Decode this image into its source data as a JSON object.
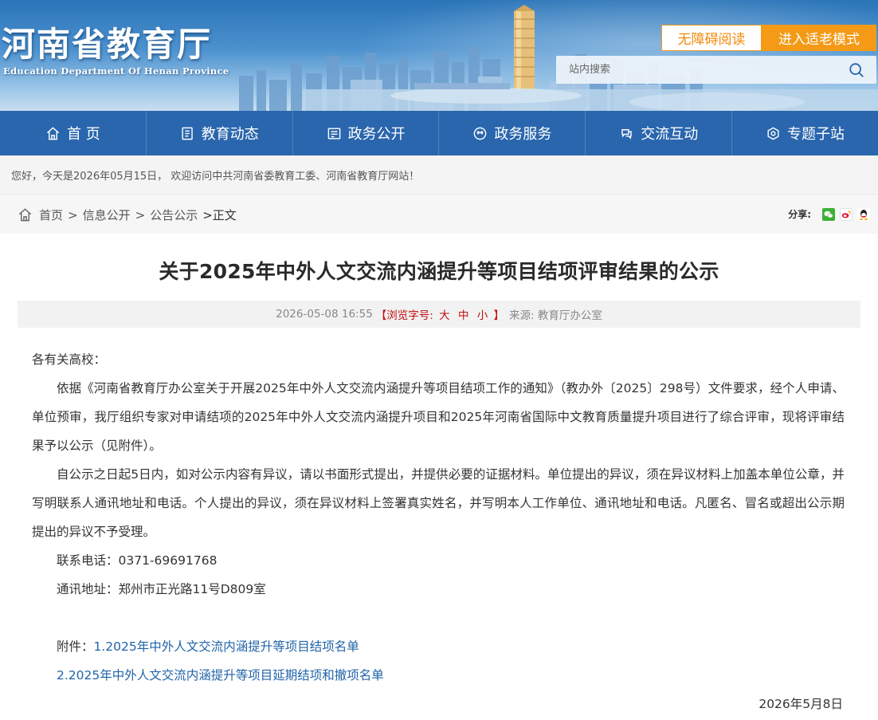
{
  "header": {
    "title_cn": "河南省教育厅",
    "title_en": "Education Department Of Henan Province",
    "accessibility_button": "无障碍阅读",
    "elder_mode_button": "进入适老模式",
    "search_placeholder": "站内搜索"
  },
  "nav": {
    "items": [
      {
        "label": "首 页",
        "icon": "home-icon"
      },
      {
        "label": "教育动态",
        "icon": "news-icon"
      },
      {
        "label": "政务公开",
        "icon": "document-icon"
      },
      {
        "label": "政务服务",
        "icon": "service-icon"
      },
      {
        "label": "交流互动",
        "icon": "chat-icon"
      },
      {
        "label": "专题子站",
        "icon": "topic-icon"
      }
    ]
  },
  "welcome_text": "您好，今天是2026年05月15日，  欢迎访问中共河南省委教育工委、河南省教育厅网站！",
  "breadcrumb": {
    "items": [
      "首页",
      "信息公开",
      "公告公示"
    ],
    "current": ">正文",
    "separator": ">"
  },
  "share": {
    "label": "分享:",
    "targets": [
      "wechat-icon",
      "weibo-icon",
      "qq-icon"
    ]
  },
  "article": {
    "title": "关于2025年中外人文交流内涵提升等项目结项评审结果的公示",
    "date": "2026-05-08 16:55",
    "font_size_prefix": "【浏览字号:",
    "font_size_large": "大",
    "font_size_medium": "中",
    "font_size_small": "小",
    "font_size_suffix": "】",
    "source": "来源: 教育厅办公室",
    "salutation": "各有关高校：",
    "para1": "依据《河南省教育厅办公室关于开展2025年中外人文交流内涵提升等项目结项工作的通知》（教办外〔2025〕298号）文件要求，经个人申请、单位预审，我厅组织专家对申请结项的2025年中外人文交流内涵提升项目和2025年河南省国际中文教育质量提升项目进行了综合评审，现将评审结果予以公示（见附件）。",
    "para2": "自公示之日起5日内，如对公示内容有异议，请以书面形式提出，并提供必要的证据材料。单位提出的异议，须在异议材料上加盖本单位公章，并写明联系人通讯地址和电话。个人提出的异议，须在异议材料上签署真实姓名，并写明本人工作单位、通讯地址和电话。凡匿名、冒名或超出公示期提出的异议不予受理。",
    "phone": "联系电话：0371-69691768",
    "address": "通讯地址：郑州市正光路11号D809室",
    "attachment_label": "附件：",
    "attachment1": "1.2025年中外人文交流内涵提升等项目结项名单",
    "attachment2": "2.2025年中外人文交流内涵提升等项目延期结项和撤项名单",
    "sign_date": "2026年5月8日"
  },
  "colors": {
    "nav_bg": "#2a66ad",
    "accent_orange": "#f49a16",
    "link_blue": "#1f63a7",
    "font_size_red": "#c30d0d"
  }
}
